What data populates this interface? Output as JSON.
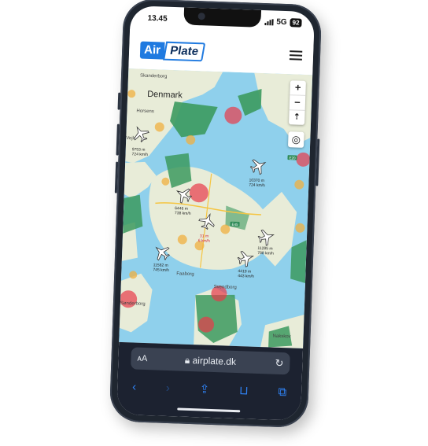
{
  "status_bar": {
    "time": "13.45",
    "network": "5G",
    "battery": "92"
  },
  "header": {
    "logo_air": "Air",
    "logo_plate": "Plate"
  },
  "map": {
    "places": [
      "Denmark",
      "Skanderborg",
      "Horsens",
      "Vejle",
      "Faaborg",
      "Svendborg",
      "Sønderborg",
      "Nakskov"
    ],
    "road_shields": [
      "E20",
      "E45"
    ],
    "planes": [
      {
        "altitude": "9753 m",
        "speed": "724 km/h"
      },
      {
        "altitude": "10370 m",
        "speed": "724 km/h"
      },
      {
        "altitude": "6446 m",
        "speed": "738 km/h"
      },
      {
        "altitude": "31 m",
        "speed": "6 km/h"
      },
      {
        "altitude": "11285 m",
        "speed": "788 km/h"
      },
      {
        "altitude": "11582 m",
        "speed": "745 km/h"
      },
      {
        "altitude": "4419 m",
        "speed": "443 km/h"
      }
    ],
    "controls": {
      "zoom_in": "+",
      "zoom_out": "−",
      "compass": "⇡",
      "locate": "◎"
    }
  },
  "browser": {
    "text_size": "ᴀA",
    "url": "airplate.dk",
    "reload": "↻"
  },
  "toolbar": {
    "back": "‹",
    "forward": "›",
    "share": "⇪",
    "bookmarks": "⊔",
    "tabs": "⧉"
  }
}
